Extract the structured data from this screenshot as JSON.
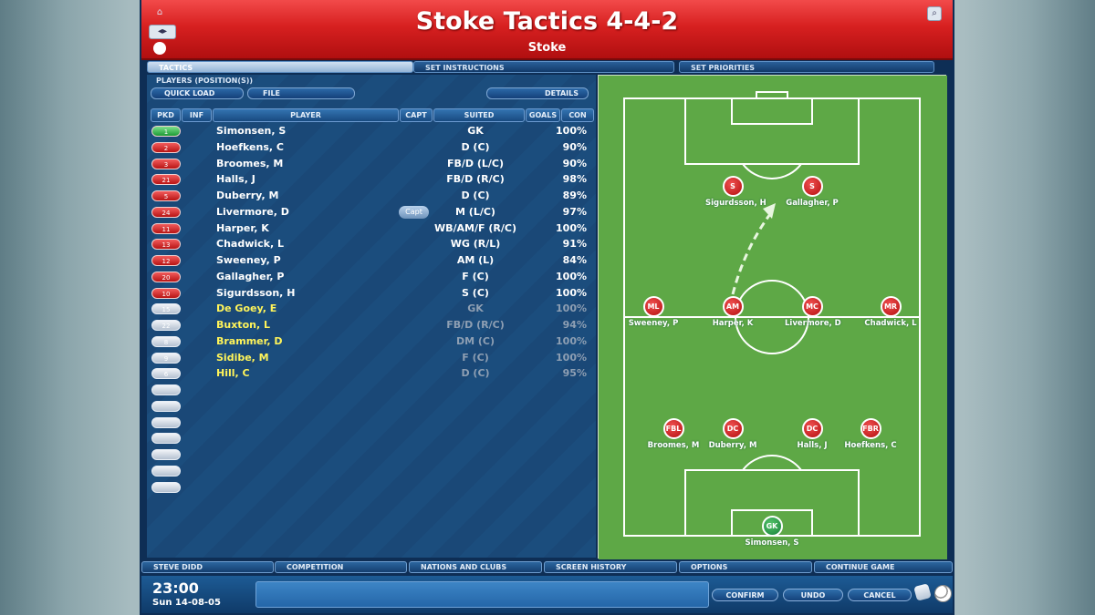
{
  "header": {
    "title": "Stoke Tactics 4-4-2",
    "subtitle": "Stoke"
  },
  "tabs": [
    "TACTICS",
    "SET INSTRUCTIONS",
    "SET PRIORITIES"
  ],
  "players_panel": {
    "label": "PLAYERS (POSITION(S))",
    "buttons": {
      "quick_load": "QUICK LOAD",
      "file": "FILE",
      "details": "DETAILS"
    },
    "columns": [
      "PKD",
      "INF",
      "PLAYER",
      "CAPT",
      "SUITED",
      "GOALS",
      "CON"
    ],
    "capt_badge": "Capt",
    "rows": [
      {
        "pkd": "1",
        "name": "Simonsen, S",
        "suited": "GK",
        "con": "100%",
        "pill": "green",
        "sub": false
      },
      {
        "pkd": "2",
        "name": "Hoefkens, C",
        "suited": "D (C)",
        "con": "90%",
        "pill": "red",
        "sub": false
      },
      {
        "pkd": "3",
        "name": "Broomes, M",
        "suited": "FB/D (L/C)",
        "con": "90%",
        "pill": "red",
        "sub": false
      },
      {
        "pkd": "21",
        "name": "Halls, J",
        "suited": "FB/D (R/C)",
        "con": "98%",
        "pill": "red",
        "sub": false
      },
      {
        "pkd": "5",
        "name": "Duberry, M",
        "suited": "D (C)",
        "con": "89%",
        "pill": "red",
        "sub": false
      },
      {
        "pkd": "24",
        "name": "Livermore, D",
        "suited": "M (L/C)",
        "con": "97%",
        "pill": "red",
        "sub": false
      },
      {
        "pkd": "11",
        "name": "Harper, K",
        "suited": "WB/AM/F (R/C)",
        "con": "100%",
        "pill": "red",
        "sub": false
      },
      {
        "pkd": "13",
        "name": "Chadwick, L",
        "suited": "WG (R/L)",
        "con": "91%",
        "pill": "red",
        "sub": false
      },
      {
        "pkd": "12",
        "name": "Sweeney, P",
        "suited": "AM (L)",
        "con": "84%",
        "pill": "red",
        "sub": false
      },
      {
        "pkd": "20",
        "name": "Gallagher, P",
        "suited": "F (C)",
        "con": "100%",
        "pill": "red",
        "sub": false
      },
      {
        "pkd": "10",
        "name": "Sigurdsson, H",
        "suited": "S (C)",
        "con": "100%",
        "pill": "red",
        "sub": false
      },
      {
        "pkd": "15",
        "name": "De Goey, E",
        "suited": "GK",
        "con": "100%",
        "pill": "empty",
        "sub": true
      },
      {
        "pkd": "22",
        "name": "Buxton, L",
        "suited": "FB/D (R/C)",
        "con": "94%",
        "pill": "empty",
        "sub": true
      },
      {
        "pkd": "8",
        "name": "Brammer, D",
        "suited": "DM (C)",
        "con": "100%",
        "pill": "empty",
        "sub": true
      },
      {
        "pkd": "9",
        "name": "Sidibe, M",
        "suited": "F (C)",
        "con": "100%",
        "pill": "empty",
        "sub": true
      },
      {
        "pkd": "6",
        "name": "Hill, C",
        "suited": "D (C)",
        "con": "95%",
        "pill": "empty",
        "sub": true
      }
    ],
    "empty_slots": 7
  },
  "pitch": {
    "players": [
      {
        "pos": "S",
        "name": "Sigurdsson, H",
        "gk": false
      },
      {
        "pos": "S",
        "name": "Gallagher, P",
        "gk": false
      },
      {
        "pos": "ML",
        "name": "Sweeney, P",
        "gk": false
      },
      {
        "pos": "AM",
        "name": "Harper, K",
        "gk": false
      },
      {
        "pos": "MC",
        "name": "Livermore, D",
        "gk": false
      },
      {
        "pos": "MR",
        "name": "Chadwick, L",
        "gk": false
      },
      {
        "pos": "FBL",
        "name": "Broomes, M",
        "gk": false
      },
      {
        "pos": "DC",
        "name": "Duberry, M",
        "gk": false
      },
      {
        "pos": "DC",
        "name": "Halls, J",
        "gk": false
      },
      {
        "pos": "FBR",
        "name": "Hoefkens, C",
        "gk": false
      },
      {
        "pos": "GK",
        "name": "Simonsen, S",
        "gk": true
      }
    ]
  },
  "bottom_tabs": [
    "STEVE DIDD",
    "COMPETITION",
    "NATIONS AND CLUBS",
    "SCREEN HISTORY",
    "OPTIONS",
    "CONTINUE GAME"
  ],
  "status": {
    "time": "23:00",
    "date": "Sun 14-08-05",
    "actions": [
      "CONFIRM",
      "UNDO",
      "CANCEL"
    ]
  },
  "colors": {
    "header_red": "#d72020",
    "panel_blue": "#1b4d7d",
    "pitch_green": "#5ea846",
    "sub_name_yellow": "#fff45a"
  },
  "icons": [
    "home-icon",
    "nav-arrows-icon",
    "zoom-icon",
    "hint-icon",
    "ball-icon"
  ]
}
